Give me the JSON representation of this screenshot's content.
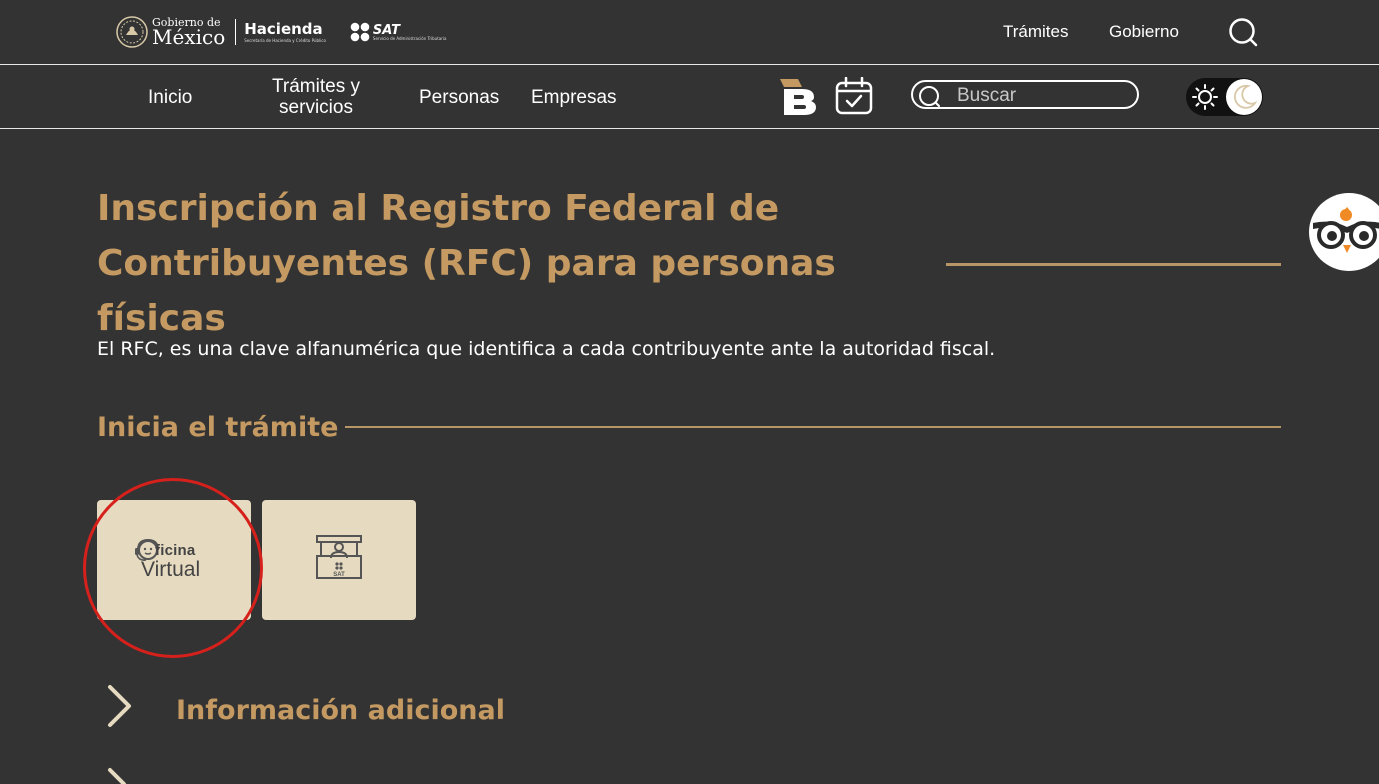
{
  "header": {
    "gob_small": "Gobierno de",
    "gob_big": "México",
    "hacienda_big": "Hacienda",
    "hacienda_small": "Secretaría de Hacienda y Crédito Público",
    "sat_big": "SAT",
    "sat_small": "Servicio de Administración Tributaria",
    "links": [
      "Trámites",
      "Gobierno"
    ]
  },
  "nav": {
    "items": [
      "Inicio",
      "Trámites y servicios",
      "Personas",
      "Empresas"
    ],
    "search_placeholder": "Buscar"
  },
  "main": {
    "title": "Inscripción al Registro Federal de Contribuyentes (RFC) para personas físicas",
    "intro": "El RFC, es una clave alfanumérica que identifica a cada contribuyente ante la autoridad fiscal.",
    "section_title": "Inicia el trámite",
    "cards": [
      {
        "top": "ficina",
        "bottom": "Virtual",
        "icon": "oficina-virtual-icon"
      },
      {
        "text": "SAT",
        "icon": "sat-office-icon"
      }
    ],
    "accordion": [
      "Información adicional"
    ]
  },
  "colors": {
    "background": "#333333",
    "accent": "#c49a62",
    "card": "#e6dac1",
    "highlight": "#d6201b"
  }
}
